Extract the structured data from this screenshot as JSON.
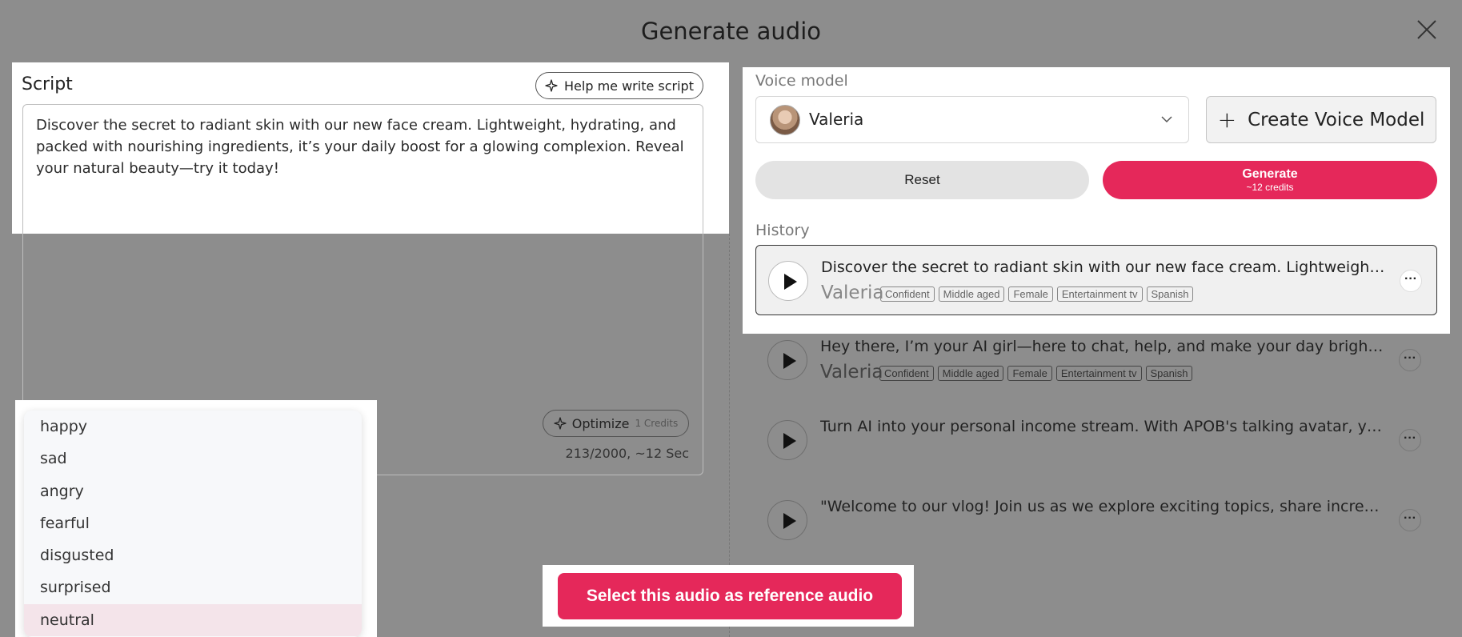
{
  "dialog": {
    "title": "Generate audio"
  },
  "script": {
    "label": "Script",
    "help_button": "Help me write script",
    "text": "Discover the secret to radiant skin with our new face cream. Lightweight, hydrating, and packed with nourishing ingredients, it’s your daily boost for a glowing complexion. Reveal your natural beauty—try it today!",
    "optimize_button": "Optimize",
    "optimize_credits": "1 Credits",
    "counter": "213/2000, ~12 Sec"
  },
  "emotions": {
    "options": [
      "happy",
      "sad",
      "angry",
      "fearful",
      "disgusted",
      "surprised",
      "neutral"
    ],
    "selected": "neutral"
  },
  "voice": {
    "label": "Voice model",
    "selected_name": "Valeria",
    "create_button": "Create Voice Model"
  },
  "actions": {
    "reset": "Reset",
    "generate": "Generate",
    "generate_credits": "~12 credits"
  },
  "history": {
    "label": "History",
    "items": [
      {
        "text": "Discover the secret to radiant skin with our new face cream. Lightweight, hydrating, and packed with nourishing ingredients",
        "voice": "Valeria",
        "tags": [
          "Confident",
          "Middle aged",
          "Female",
          "Entertainment tv",
          "Spanish"
        ]
      },
      {
        "text": "Hey there, I’m your AI girl—here to chat, help, and make your day brighter. We can talk about anything",
        "voice": "Valeria",
        "tags": [
          "Confident",
          "Middle aged",
          "Female",
          "Entertainment tv",
          "Spanish"
        ]
      },
      {
        "text": "Turn AI into your personal income stream. With APOB's talking avatar, you can create content that earns"
      },
      {
        "text": "\"Welcome to our vlog! Join us as we explore exciting topics, share incredible stories and moments"
      }
    ]
  },
  "cta": {
    "label": "Select this audio as reference audio"
  },
  "icons": {
    "close": "close-icon",
    "sparkle": "sparkle-icon",
    "chevron": "chevron-down-icon",
    "plus": "plus-icon",
    "play": "play-icon",
    "more": "more-icon"
  },
  "colors": {
    "accent": "#e5285a",
    "overlay": "#8d8d8d"
  }
}
